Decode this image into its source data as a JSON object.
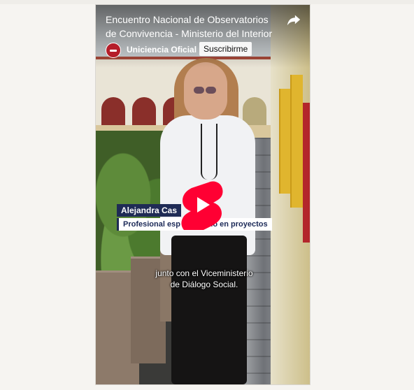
{
  "video": {
    "title": "Encuentro Nacional de Observatorios de Convivencia - Ministerio del Interior",
    "channel_name": "Uniciencia Oficial",
    "subscribe_label": "Suscribirme",
    "share_icon": "share-arrow-icon",
    "play_icon": "youtube-shorts-play-icon"
  },
  "lower_third": {
    "name": "Alejandra Cas",
    "role": "Profesional esp           ado en proyectos"
  },
  "caption": {
    "line1": "junto con el Viceministerio",
    "line2": "de Diálogo Social."
  },
  "colors": {
    "page_background": "#f6f4f1",
    "shorts_red": "#ff0033",
    "name_bar": "#1f2b55"
  }
}
